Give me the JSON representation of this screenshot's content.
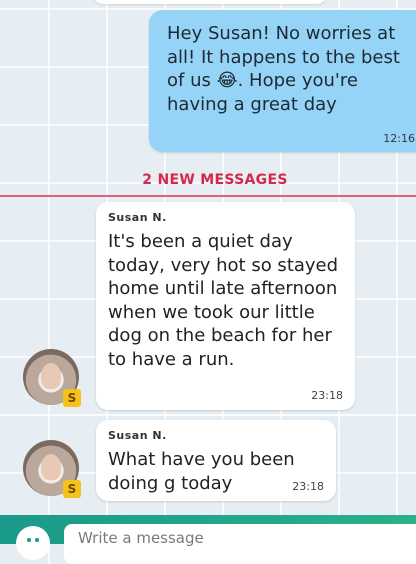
{
  "outgoing": {
    "text": "Hey Susan! No worries at all! It happens to the best of us 😂. Hope you're having a great day",
    "time": "12:16"
  },
  "new_messages_label": "2 NEW MESSAGES",
  "incoming": [
    {
      "sender": "Susan N.",
      "text": "It's been a quiet day today, very hot so stayed home until late afternoon when we took our little dog on the beach for her to have a run.",
      "time": "23:18",
      "badge": "S"
    },
    {
      "sender": "Susan N.",
      "text": "What have you been doing g today",
      "time": "23:18",
      "badge": "S"
    }
  ],
  "composer": {
    "placeholder": "Write a message",
    "emoji_icon": "emoji-icon"
  }
}
